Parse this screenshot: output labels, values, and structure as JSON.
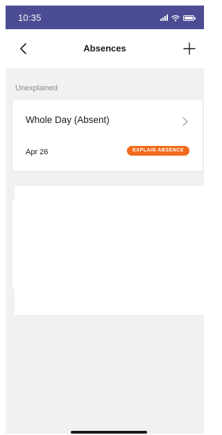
{
  "status_bar": {
    "time": "10:35",
    "background_color": "#4c4c94",
    "icons": [
      "signal-icon",
      "wifi-icon",
      "battery-icon"
    ]
  },
  "nav_bar": {
    "title": "Absences",
    "back_icon": "chevron-left-icon",
    "add_icon": "plus-icon"
  },
  "section": {
    "header": "Unexplained"
  },
  "absence_card": {
    "title": "Whole Day (Absent)",
    "date": "Apr 26",
    "action_label": "EXPLAIN ABSENCE",
    "action_color": "#f26a1b",
    "chevron_icon": "chevron-right-icon"
  }
}
